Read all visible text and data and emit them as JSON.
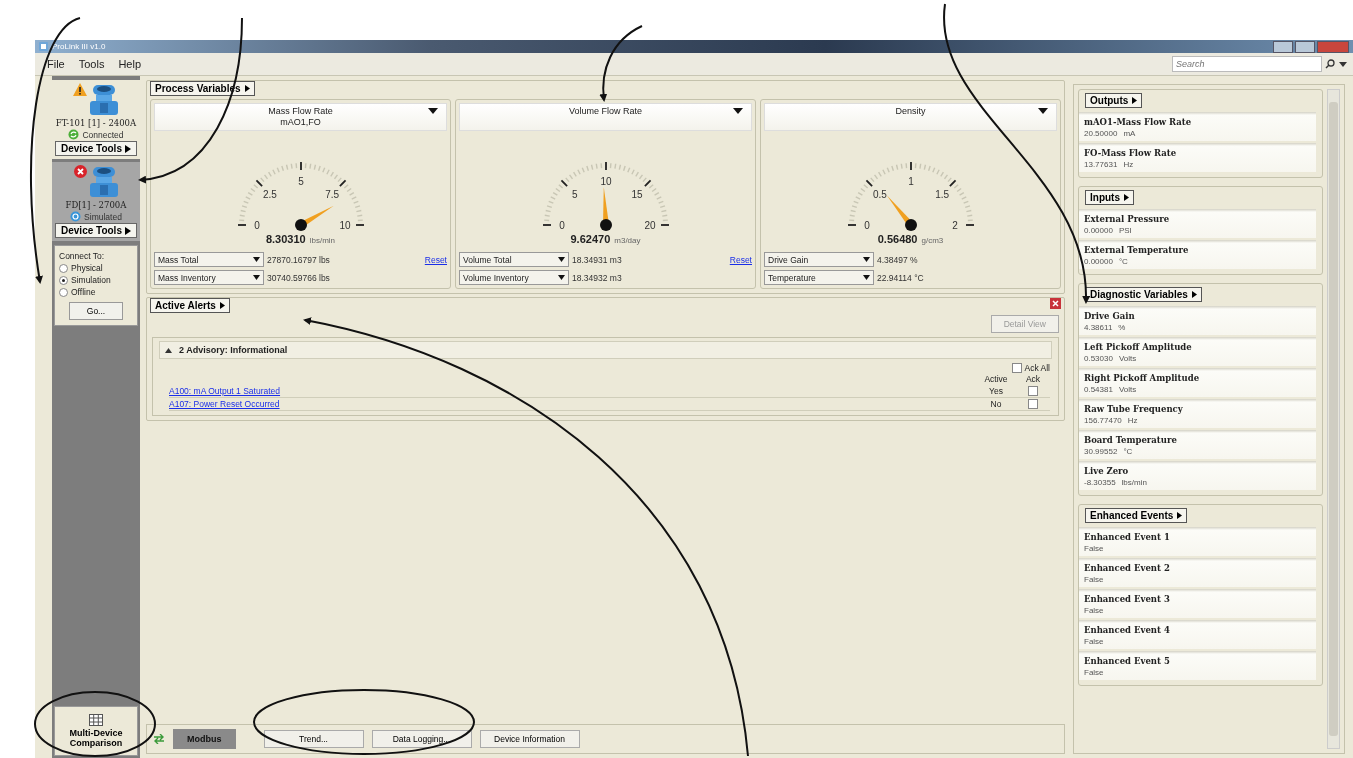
{
  "window": {
    "title": "ProLink III v1.0"
  },
  "menu": [
    "File",
    "Tools",
    "Help"
  ],
  "search": {
    "placeholder": "Search"
  },
  "devices": [
    {
      "name": "FT-101 [1] - 2400A",
      "alert": {
        "kind": "warning"
      },
      "status": {
        "text": "Connected",
        "kind": "connected"
      },
      "tools": "Device Tools",
      "selected": false
    },
    {
      "name": "FD[1] - 2700A",
      "alert": {
        "kind": "error"
      },
      "status": {
        "text": "Simulated",
        "kind": "simulated"
      },
      "tools": "Device Tools",
      "selected": true
    }
  ],
  "connect": {
    "label": "Connect To:",
    "options": [
      {
        "label": "Physical",
        "selected": false
      },
      {
        "label": "Simulation",
        "selected": true
      },
      {
        "label": "Offline",
        "selected": false
      }
    ],
    "button": "Go..."
  },
  "multi_device": {
    "label": "Multi-Device Comparison"
  },
  "process_variables": {
    "title": "Process Variables",
    "gauges": [
      {
        "title": "Mass Flow Rate",
        "subtitle": "mAO1,FO",
        "ticks": [
          "0",
          "2.5",
          "5",
          "7.5",
          "10"
        ],
        "value": "8.30310",
        "unit": "lbs/min",
        "rows": [
          {
            "label": "Mass Total",
            "value": "27870.16797 lbs"
          },
          {
            "label": "Mass Inventory",
            "value": "30740.59766 lbs"
          }
        ],
        "reset": "Reset"
      },
      {
        "title": "Volume Flow Rate",
        "ticks": [
          "0",
          "5",
          "10",
          "15",
          "20"
        ],
        "value": "9.62470",
        "unit": "m3/day",
        "rows": [
          {
            "label": "Volume Total",
            "value": "18.34931 m3"
          },
          {
            "label": "Volume Inventory",
            "value": "18.34932 m3"
          }
        ],
        "reset": "Reset"
      },
      {
        "title": "Density",
        "ticks": [
          "0",
          "0.5",
          "1",
          "1.5",
          "2"
        ],
        "value": "0.56480",
        "unit": "g/cm3",
        "rows": [
          {
            "label": "Drive Gain",
            "value": "4.38497 %"
          },
          {
            "label": "Temperature",
            "value": "22.94114 °C"
          }
        ]
      }
    ]
  },
  "alerts": {
    "title": "Active Alerts",
    "detail_button": {
      "label": "Detail View",
      "disabled": true
    },
    "group": {
      "title": "2 Advisory: Informational",
      "expanded": true
    },
    "ack_all": {
      "label": "Ack All",
      "checked": false
    },
    "columns": [
      "Active",
      "Ack"
    ],
    "rows": [
      {
        "name": "A100: mA Output 1 Saturated",
        "active": "Yes",
        "ack": false
      },
      {
        "name": "A107: Power Reset Occurred",
        "active": "No",
        "ack": false
      }
    ]
  },
  "bottom_bar": {
    "protocol": "Modbus",
    "buttons": [
      "Trend...",
      "Data Logging...",
      "Device Information"
    ]
  },
  "side_sections": [
    {
      "title": "Outputs",
      "items": [
        {
          "name": "mAO1-Mass Flow Rate",
          "value": "20.50000",
          "unit": "mA"
        },
        {
          "name": "FO-Mass Flow Rate",
          "value": "13.77631",
          "unit": "Hz"
        }
      ]
    },
    {
      "title": "Inputs",
      "items": [
        {
          "name": "External Pressure",
          "value": "0.00000",
          "unit": "PSI"
        },
        {
          "name": "External Temperature",
          "value": "0.00000",
          "unit": "°C"
        }
      ]
    },
    {
      "title": "Diagnostic Variables",
      "items": [
        {
          "name": "Drive Gain",
          "value": "4.38611",
          "unit": "%"
        },
        {
          "name": "Left Pickoff Amplitude",
          "value": "0.53030",
          "unit": "Volts"
        },
        {
          "name": "Right Pickoff Amplitude",
          "value": "0.54381",
          "unit": "Volts"
        },
        {
          "name": "Raw Tube Frequency",
          "value": "156.77470",
          "unit": "Hz"
        },
        {
          "name": "Board Temperature",
          "value": "30.99552",
          "unit": "°C"
        },
        {
          "name": "Live Zero",
          "value": "-8.30355",
          "unit": "lbs/min"
        }
      ]
    },
    {
      "title": "Enhanced Events",
      "items": [
        {
          "name": "Enhanced Event 1",
          "value": "False"
        },
        {
          "name": "Enhanced Event 2",
          "value": "False"
        },
        {
          "name": "Enhanced Event 3",
          "value": "False"
        },
        {
          "name": "Enhanced Event 4",
          "value": "False"
        },
        {
          "name": "Enhanced Event 5",
          "value": "False"
        }
      ]
    }
  ]
}
